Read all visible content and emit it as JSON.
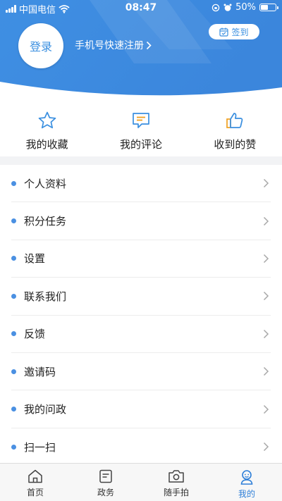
{
  "status_bar": {
    "carrier": "中国电信",
    "time": "08:47",
    "battery": "50%",
    "battery_level": 0.5
  },
  "profile": {
    "login_label": "登录",
    "register_label": "手机号快速注册",
    "signin_label": "签到"
  },
  "quick_actions": [
    {
      "label": "我的收藏",
      "icon": "star-icon"
    },
    {
      "label": "我的评论",
      "icon": "comment-icon"
    },
    {
      "label": "收到的赞",
      "icon": "thumbs-up-icon"
    }
  ],
  "menu": [
    {
      "label": "个人资料"
    },
    {
      "label": "积分任务"
    },
    {
      "label": "设置"
    },
    {
      "label": "联系我们"
    },
    {
      "label": "反馈"
    },
    {
      "label": "邀请码"
    },
    {
      "label": "我的问政"
    },
    {
      "label": "扫一扫"
    }
  ],
  "tabs": [
    {
      "label": "首页",
      "icon": "home-icon",
      "active": false
    },
    {
      "label": "政务",
      "icon": "document-icon",
      "active": false
    },
    {
      "label": "随手拍",
      "icon": "camera-icon",
      "active": false
    },
    {
      "label": "我的",
      "icon": "profile-icon",
      "active": true
    }
  ],
  "colors": {
    "primary": "#3a8fe0",
    "accent": "#2e7fd8",
    "header_light": "#5aa6f0"
  }
}
